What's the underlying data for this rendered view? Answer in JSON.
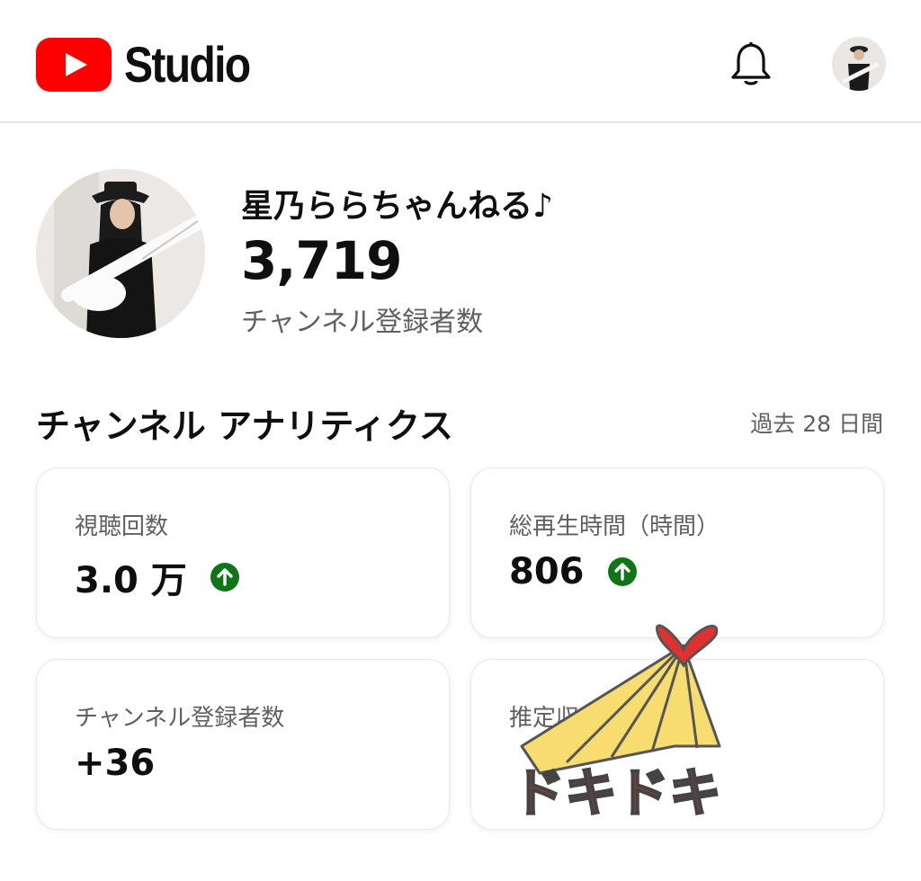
{
  "header": {
    "logo_text": "Studio",
    "logo_icon": "youtube-play-icon",
    "notification_icon": "bell-icon",
    "account_icon": "avatar"
  },
  "channel": {
    "name": "星乃ららちゃんねる♪",
    "subscriber_count": "3,719",
    "subscriber_label": "チャンネル登録者数"
  },
  "analytics": {
    "title": "チャンネル アナリティクス",
    "period": "過去 28 日間",
    "cards": [
      {
        "label": "視聴回数",
        "value": "3.0 万",
        "trend": "up"
      },
      {
        "label": "総再生時間（時間）",
        "value": "806",
        "trend": "up"
      },
      {
        "label": "チャンネル登録者数",
        "value": "+36",
        "trend": ""
      },
      {
        "label": "推定収益",
        "value": "",
        "trend": ""
      }
    ]
  },
  "sticker": {
    "text": "ドキドキ",
    "colors": {
      "heart": "#e03030",
      "rays": "#f7dc6f",
      "text": "#e03030"
    }
  },
  "colors": {
    "brand_red": "#ff0000",
    "trend_up": "#107516",
    "muted_text": "#606060"
  }
}
